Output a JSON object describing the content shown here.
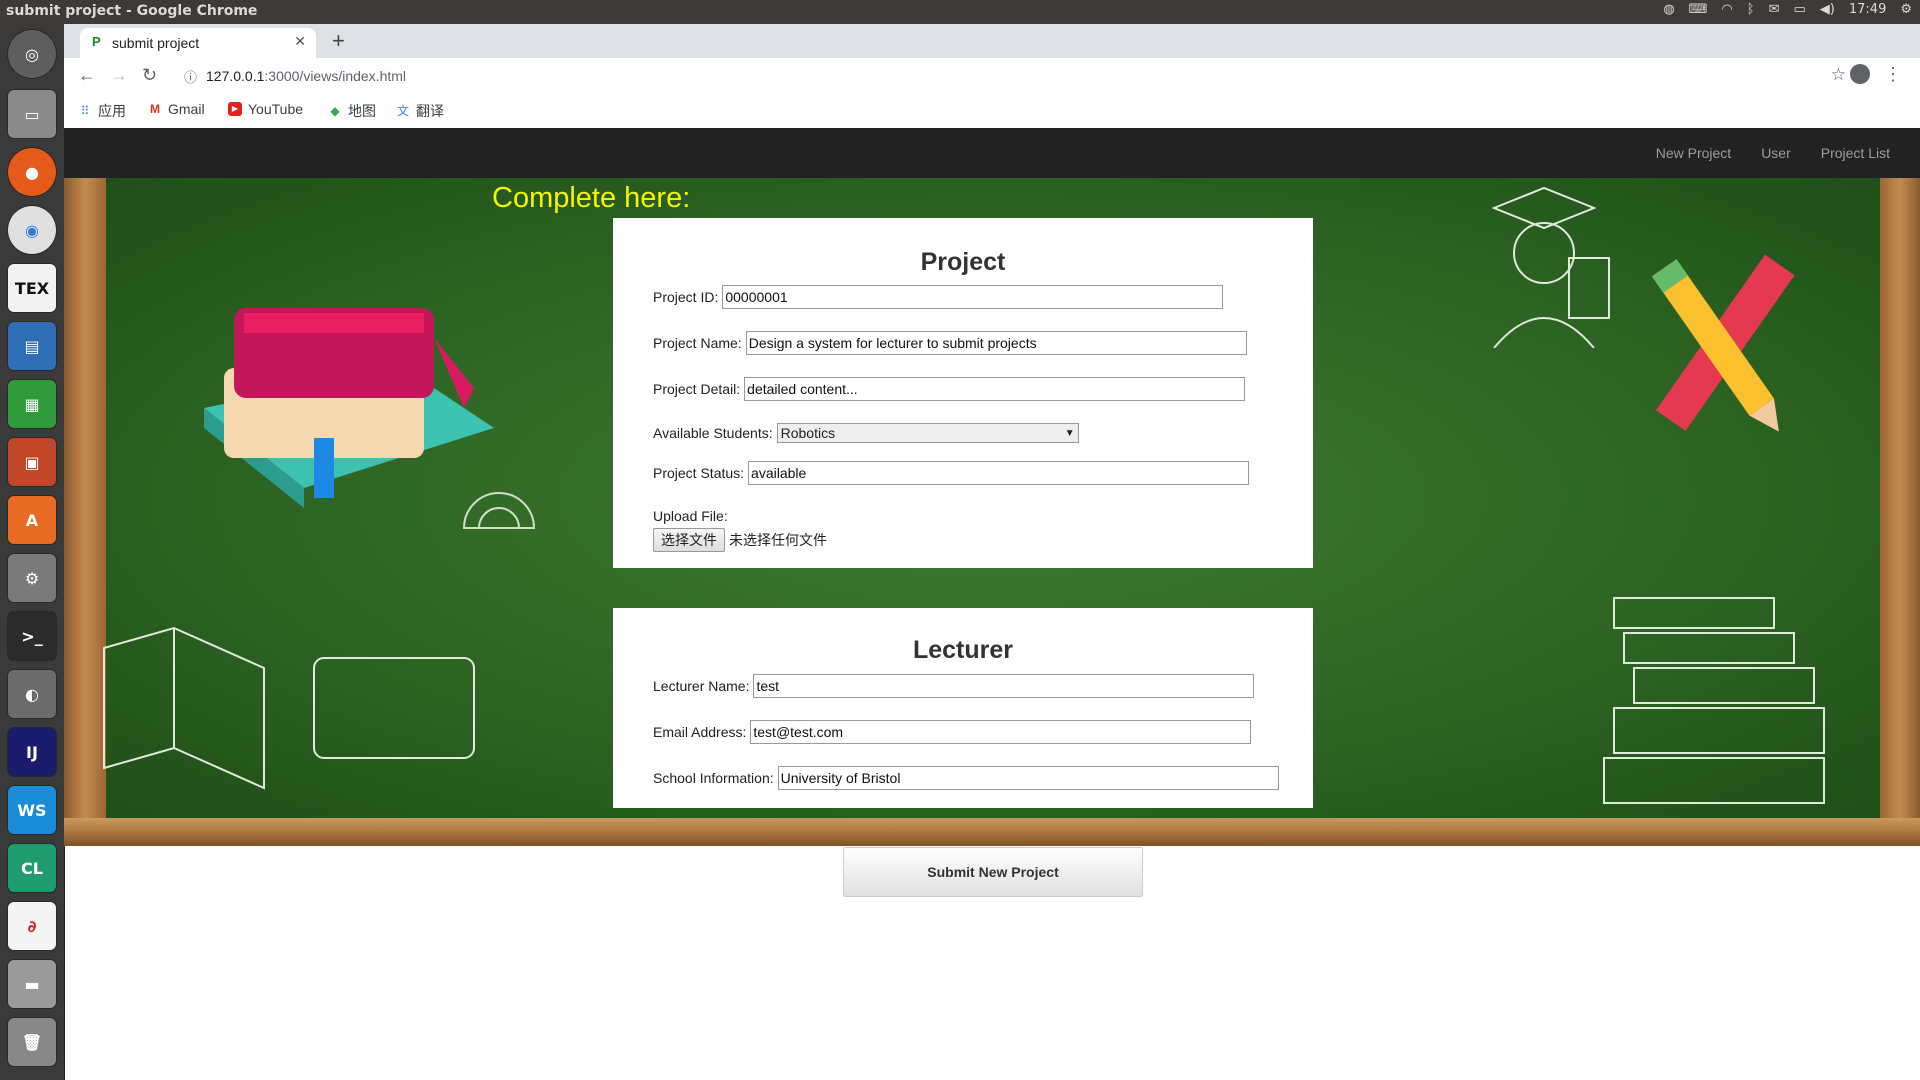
{
  "os": {
    "window_title": "submit project - Google Chrome",
    "clock": "17:49"
  },
  "browser": {
    "tab_title": "submit project",
    "tab_favicon": "P",
    "url_host": "127.0.0.1",
    "url_path": ":3000/views/index.html",
    "bookmarks": [
      "应用",
      "Gmail",
      "YouTube",
      "地图",
      "翻译"
    ]
  },
  "nav": {
    "links": [
      "New Project",
      "User",
      "Project List"
    ]
  },
  "page": {
    "heading": "Complete here:"
  },
  "project": {
    "title": "Project",
    "id_label": "Project ID:",
    "id_value": "00000001",
    "name_label": "Project Name:",
    "name_value": "Design a system for lecturer to submit projects",
    "detail_label": "Project Detail:",
    "detail_value": "detailed content...",
    "students_label": "Available Students:",
    "students_selected": "Robotics",
    "status_label": "Project Status:",
    "status_value": "available",
    "upload_label": "Upload File:",
    "choose_file": "选择文件",
    "no_file": "未选择任何文件"
  },
  "lecturer": {
    "title": "Lecturer",
    "name_label": "Lecturer Name:",
    "name_value": "test",
    "email_label": "Email Address:",
    "email_value": "test@test.com",
    "school_label": "School Information:",
    "school_value": "University of Bristol"
  },
  "submit_label": "Submit New Project",
  "colors": {
    "heading": "#f5f500",
    "navbar": "#222222",
    "board": "#2c6322"
  }
}
